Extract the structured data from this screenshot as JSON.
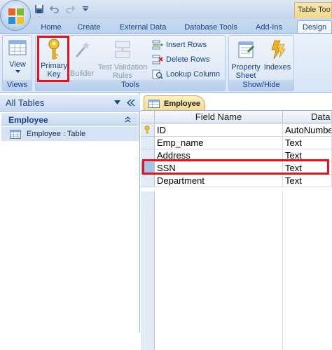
{
  "title_bar": {
    "context_tab_title": "Table Too",
    "quick_access": [
      "save-icon",
      "undo-icon",
      "redo-icon",
      "customize-icon"
    ]
  },
  "tabs": [
    "Home",
    "Create",
    "External Data",
    "Database Tools",
    "Add-Ins",
    "Design"
  ],
  "active_tab": "Design",
  "ribbon": {
    "views_group": {
      "label": "Views",
      "view_button": "View"
    },
    "tools_group": {
      "label": "Tools",
      "primary_key_line1": "Primary",
      "primary_key_line2": "Key",
      "builder": "Builder",
      "test_validation_line1": "Test Validation",
      "test_validation_line2": "Rules",
      "insert_rows": "Insert Rows",
      "delete_rows": "Delete Rows",
      "lookup_column": "Lookup Column"
    },
    "showhide_group": {
      "label": "Show/Hide",
      "property_sheet_line1": "Property",
      "property_sheet_line2": "Sheet",
      "indexes": "Indexes"
    }
  },
  "nav_pane": {
    "header": "All Tables",
    "group": "Employee",
    "item": "Employee : Table"
  },
  "document": {
    "tab_label": "Employee",
    "columns": [
      "Field Name",
      "Data"
    ],
    "rows": [
      {
        "field": "ID",
        "type": "AutoNumber",
        "primary_key": true
      },
      {
        "field": "Emp_name",
        "type": "Text",
        "primary_key": false
      },
      {
        "field": "Address",
        "type": "Text",
        "primary_key": false
      },
      {
        "field": "SSN",
        "type": "Text",
        "primary_key": false,
        "current": true
      },
      {
        "field": "Department",
        "type": "Text",
        "primary_key": false
      }
    ]
  },
  "colors": {
    "highlight": "#e4141e",
    "ribbon_text": "#15428b",
    "tab_gold": "#f7d98a"
  }
}
